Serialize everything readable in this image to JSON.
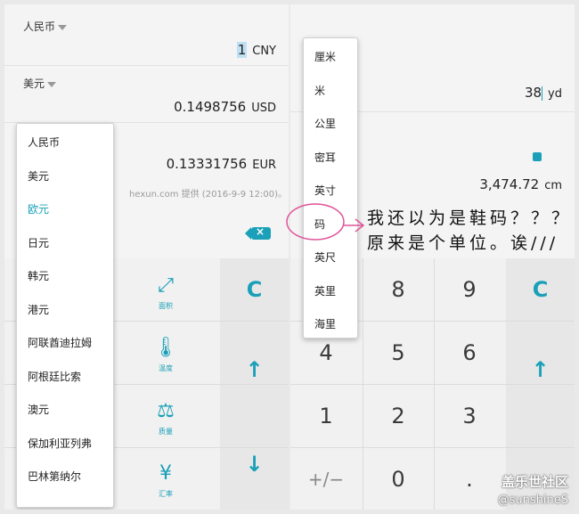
{
  "left": {
    "from": {
      "currency": "人民币",
      "amount": "1",
      "code": "CNY"
    },
    "to1": {
      "currency": "美元",
      "amount": "0.1498756",
      "code": "USD"
    },
    "to2": {
      "amount": "0.13331756",
      "code": "EUR"
    },
    "source": "hexun.com 提供 (2016-9-9 12:00)。",
    "dropdown": {
      "items": [
        "人民币",
        "美元",
        "欧元",
        "日元",
        "韩元",
        "港元",
        "阿联酋迪拉姆",
        "阿根廷比索",
        "澳元",
        "保加利亚列弗",
        "巴林第纳尔"
      ],
      "selected": "欧元"
    },
    "categories": [
      {
        "label": "面积",
        "icon": "area-icon"
      },
      {
        "label": "温度",
        "icon": "thermometer-icon"
      },
      {
        "label": "质量",
        "icon": "scale-icon"
      },
      {
        "label": "汇率",
        "icon": "yen-icon"
      }
    ],
    "keys": {
      "clear": "C",
      "up": "↑",
      "down": "↓"
    }
  },
  "right": {
    "input": {
      "amount": "38",
      "unit": "yd"
    },
    "result": {
      "amount": "3,474.72",
      "unit": "cm"
    },
    "dropdown": {
      "items": [
        "厘米",
        "米",
        "公里",
        "密耳",
        "英寸",
        "码",
        "英尺",
        "英里",
        "海里"
      ],
      "highlighted": "码"
    },
    "keys": {
      "r1": [
        "8",
        "9"
      ],
      "r2": [
        "4",
        "5",
        "6"
      ],
      "r3": [
        "1",
        "2",
        "3"
      ],
      "r4": [
        "+/−",
        "0",
        "."
      ],
      "clear": "C",
      "up": "↑",
      "down": "↓"
    }
  },
  "annotation": {
    "line1": "我还以为是鞋码？？？",
    "line2": "原来是个单位。诶///"
  },
  "watermark": {
    "line1": "盖乐世社区",
    "line2": "@sunshineS"
  },
  "colors": {
    "accent": "#1aa0b8",
    "annotation_pink": "#e0559a"
  }
}
